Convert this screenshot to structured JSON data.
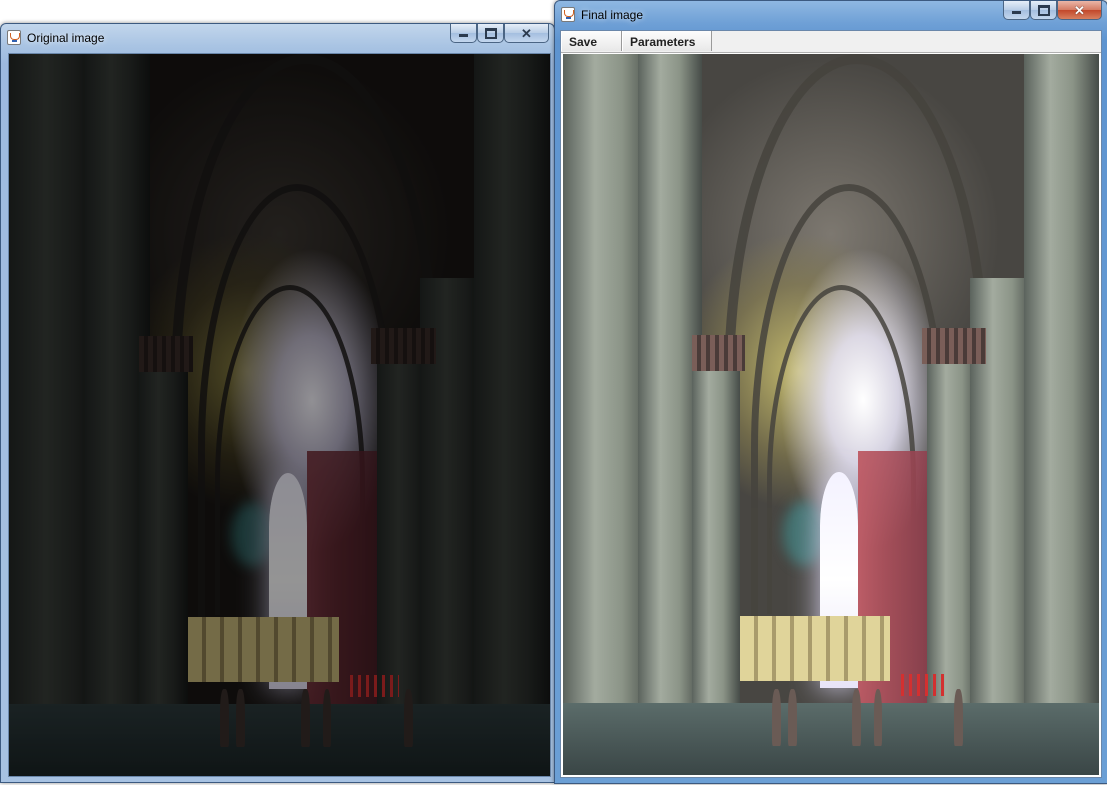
{
  "windows": {
    "original": {
      "title": "Original image",
      "icon": "java-icon",
      "controls": [
        "minimize-icon",
        "maximize-icon",
        "close-icon"
      ],
      "active": false
    },
    "final": {
      "title": "Final image",
      "icon": "java-icon",
      "controls": [
        "minimize-icon",
        "maximize-icon",
        "close-icon"
      ],
      "active": true,
      "menu": {
        "save_label": "Save",
        "parameters_label": "Parameters"
      }
    }
  },
  "colors": {
    "title_bar_active": "#6fa0d6",
    "title_bar_inactive": "#a9c4e3",
    "close_button": "#c2472a",
    "menu_bar": "#f0f0f0"
  }
}
